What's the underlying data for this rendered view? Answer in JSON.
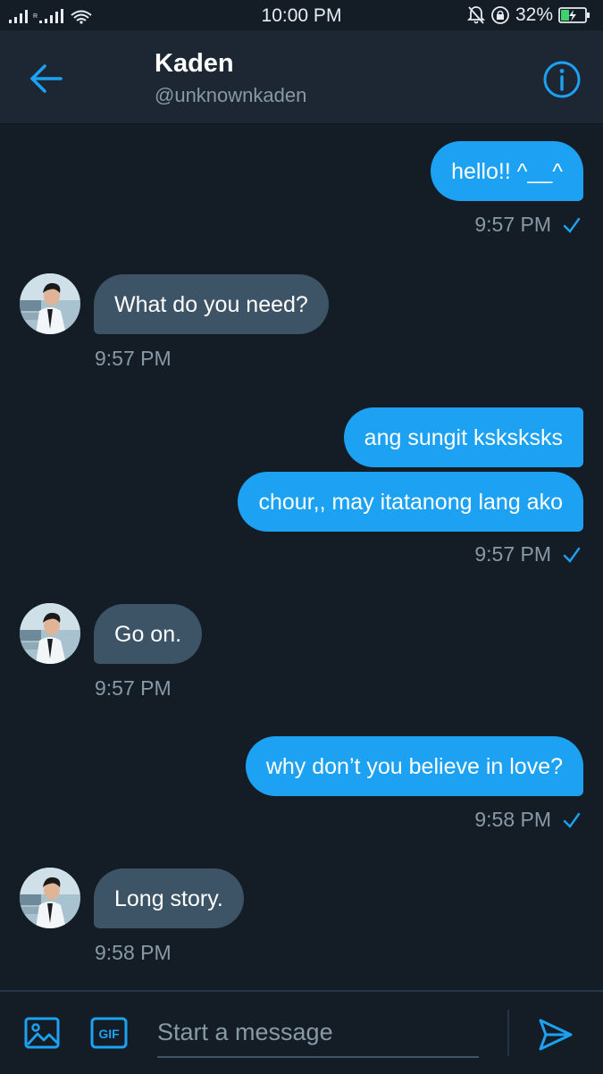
{
  "status_bar": {
    "time": "10:00 PM",
    "battery": "32%",
    "carrier_mark": "R"
  },
  "header": {
    "name": "Kaden",
    "handle": "@unknownkaden"
  },
  "messages": [
    {
      "text": "hello!! ^__^",
      "time": "9:57 PM"
    },
    {
      "text": "What do you need?",
      "time": "9:57 PM"
    },
    {
      "text": "ang sungit ksksksks"
    },
    {
      "text": "chour,, may itatanong lang ako",
      "time": "9:57 PM"
    },
    {
      "text": "Go on.",
      "time": "9:57 PM"
    },
    {
      "text": "why don’t you believe in love?",
      "time": "9:58 PM"
    },
    {
      "text": "Long story.",
      "time": "9:58 PM"
    }
  ],
  "composer": {
    "placeholder": "Start a message",
    "gif_label": "GIF"
  },
  "colors": {
    "accent": "#1da1f2",
    "background": "#141d26",
    "header": "#1c2733",
    "incoming_bubble": "#3d5466"
  }
}
